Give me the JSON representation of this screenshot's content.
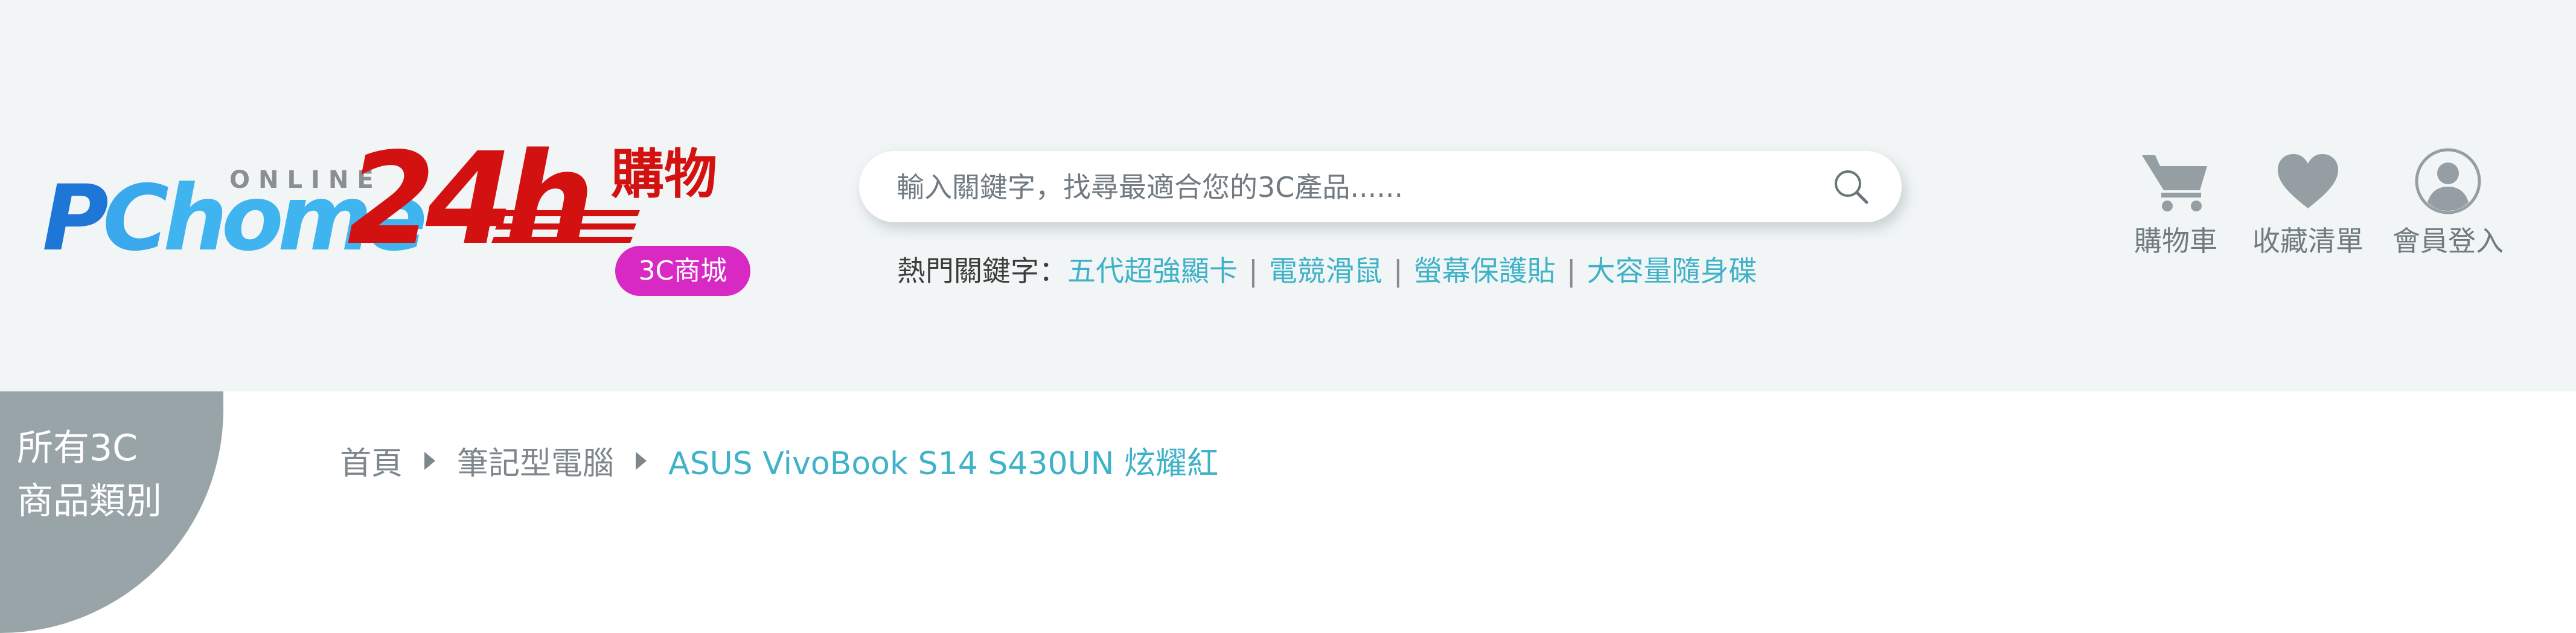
{
  "logo": {
    "online": "ONLINE",
    "pc_p": "P",
    "pc_c": "C",
    "pc_home": "home",
    "num": "24h",
    "gouwu": "購物",
    "badge": "3C商城"
  },
  "search": {
    "placeholder": "輸入關鍵字，找尋最適合您的3C產品......",
    "hot_label": "熱門關鍵字：",
    "hot_keywords": [
      "五代超強顯卡",
      "電競滑鼠",
      "螢幕保護貼",
      "大容量隨身碟"
    ]
  },
  "nav": {
    "cart": "購物車",
    "wishlist": "收藏清單",
    "login": "會員登入"
  },
  "category": {
    "line1": "所有3C",
    "line2": "商品類別"
  },
  "breadcrumb": {
    "home": "首頁",
    "category": "筆記型電腦",
    "current": "ASUS VivoBook S14 S430UN 炫耀紅"
  },
  "colors": {
    "brand_red": "#d41111",
    "brand_blue": "#1e76d6",
    "accent_teal": "#3fb2c8",
    "badge_magenta": "#d829c5",
    "header_bg": "#f1f5f5"
  }
}
